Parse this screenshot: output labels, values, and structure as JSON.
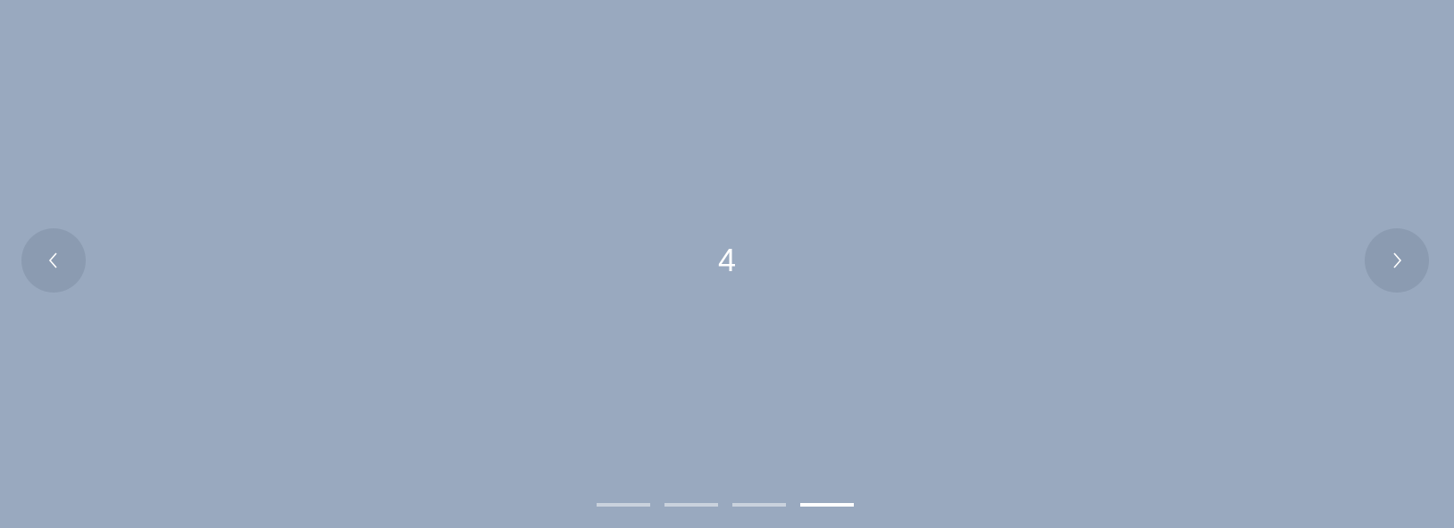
{
  "carousel": {
    "current_slide_label": "4",
    "active_index": 3,
    "indicator_count": 4,
    "background_color": "#99a9bf",
    "prev_icon": "chevron-left-icon",
    "next_icon": "chevron-right-icon"
  }
}
